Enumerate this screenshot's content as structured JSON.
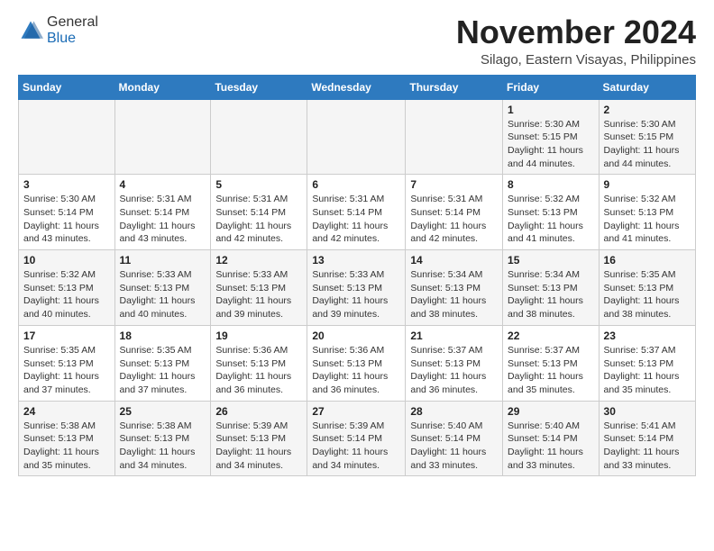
{
  "logo": {
    "general": "General",
    "blue": "Blue"
  },
  "title": "November 2024",
  "location": "Silago, Eastern Visayas, Philippines",
  "weekdays": [
    "Sunday",
    "Monday",
    "Tuesday",
    "Wednesday",
    "Thursday",
    "Friday",
    "Saturday"
  ],
  "weeks": [
    [
      {
        "day": "",
        "info": ""
      },
      {
        "day": "",
        "info": ""
      },
      {
        "day": "",
        "info": ""
      },
      {
        "day": "",
        "info": ""
      },
      {
        "day": "",
        "info": ""
      },
      {
        "day": "1",
        "info": "Sunrise: 5:30 AM\nSunset: 5:15 PM\nDaylight: 11 hours and 44 minutes."
      },
      {
        "day": "2",
        "info": "Sunrise: 5:30 AM\nSunset: 5:15 PM\nDaylight: 11 hours and 44 minutes."
      }
    ],
    [
      {
        "day": "3",
        "info": "Sunrise: 5:30 AM\nSunset: 5:14 PM\nDaylight: 11 hours and 43 minutes."
      },
      {
        "day": "4",
        "info": "Sunrise: 5:31 AM\nSunset: 5:14 PM\nDaylight: 11 hours and 43 minutes."
      },
      {
        "day": "5",
        "info": "Sunrise: 5:31 AM\nSunset: 5:14 PM\nDaylight: 11 hours and 42 minutes."
      },
      {
        "day": "6",
        "info": "Sunrise: 5:31 AM\nSunset: 5:14 PM\nDaylight: 11 hours and 42 minutes."
      },
      {
        "day": "7",
        "info": "Sunrise: 5:31 AM\nSunset: 5:14 PM\nDaylight: 11 hours and 42 minutes."
      },
      {
        "day": "8",
        "info": "Sunrise: 5:32 AM\nSunset: 5:13 PM\nDaylight: 11 hours and 41 minutes."
      },
      {
        "day": "9",
        "info": "Sunrise: 5:32 AM\nSunset: 5:13 PM\nDaylight: 11 hours and 41 minutes."
      }
    ],
    [
      {
        "day": "10",
        "info": "Sunrise: 5:32 AM\nSunset: 5:13 PM\nDaylight: 11 hours and 40 minutes."
      },
      {
        "day": "11",
        "info": "Sunrise: 5:33 AM\nSunset: 5:13 PM\nDaylight: 11 hours and 40 minutes."
      },
      {
        "day": "12",
        "info": "Sunrise: 5:33 AM\nSunset: 5:13 PM\nDaylight: 11 hours and 39 minutes."
      },
      {
        "day": "13",
        "info": "Sunrise: 5:33 AM\nSunset: 5:13 PM\nDaylight: 11 hours and 39 minutes."
      },
      {
        "day": "14",
        "info": "Sunrise: 5:34 AM\nSunset: 5:13 PM\nDaylight: 11 hours and 38 minutes."
      },
      {
        "day": "15",
        "info": "Sunrise: 5:34 AM\nSunset: 5:13 PM\nDaylight: 11 hours and 38 minutes."
      },
      {
        "day": "16",
        "info": "Sunrise: 5:35 AM\nSunset: 5:13 PM\nDaylight: 11 hours and 38 minutes."
      }
    ],
    [
      {
        "day": "17",
        "info": "Sunrise: 5:35 AM\nSunset: 5:13 PM\nDaylight: 11 hours and 37 minutes."
      },
      {
        "day": "18",
        "info": "Sunrise: 5:35 AM\nSunset: 5:13 PM\nDaylight: 11 hours and 37 minutes."
      },
      {
        "day": "19",
        "info": "Sunrise: 5:36 AM\nSunset: 5:13 PM\nDaylight: 11 hours and 36 minutes."
      },
      {
        "day": "20",
        "info": "Sunrise: 5:36 AM\nSunset: 5:13 PM\nDaylight: 11 hours and 36 minutes."
      },
      {
        "day": "21",
        "info": "Sunrise: 5:37 AM\nSunset: 5:13 PM\nDaylight: 11 hours and 36 minutes."
      },
      {
        "day": "22",
        "info": "Sunrise: 5:37 AM\nSunset: 5:13 PM\nDaylight: 11 hours and 35 minutes."
      },
      {
        "day": "23",
        "info": "Sunrise: 5:37 AM\nSunset: 5:13 PM\nDaylight: 11 hours and 35 minutes."
      }
    ],
    [
      {
        "day": "24",
        "info": "Sunrise: 5:38 AM\nSunset: 5:13 PM\nDaylight: 11 hours and 35 minutes."
      },
      {
        "day": "25",
        "info": "Sunrise: 5:38 AM\nSunset: 5:13 PM\nDaylight: 11 hours and 34 minutes."
      },
      {
        "day": "26",
        "info": "Sunrise: 5:39 AM\nSunset: 5:13 PM\nDaylight: 11 hours and 34 minutes."
      },
      {
        "day": "27",
        "info": "Sunrise: 5:39 AM\nSunset: 5:14 PM\nDaylight: 11 hours and 34 minutes."
      },
      {
        "day": "28",
        "info": "Sunrise: 5:40 AM\nSunset: 5:14 PM\nDaylight: 11 hours and 33 minutes."
      },
      {
        "day": "29",
        "info": "Sunrise: 5:40 AM\nSunset: 5:14 PM\nDaylight: 11 hours and 33 minutes."
      },
      {
        "day": "30",
        "info": "Sunrise: 5:41 AM\nSunset: 5:14 PM\nDaylight: 11 hours and 33 minutes."
      }
    ]
  ]
}
